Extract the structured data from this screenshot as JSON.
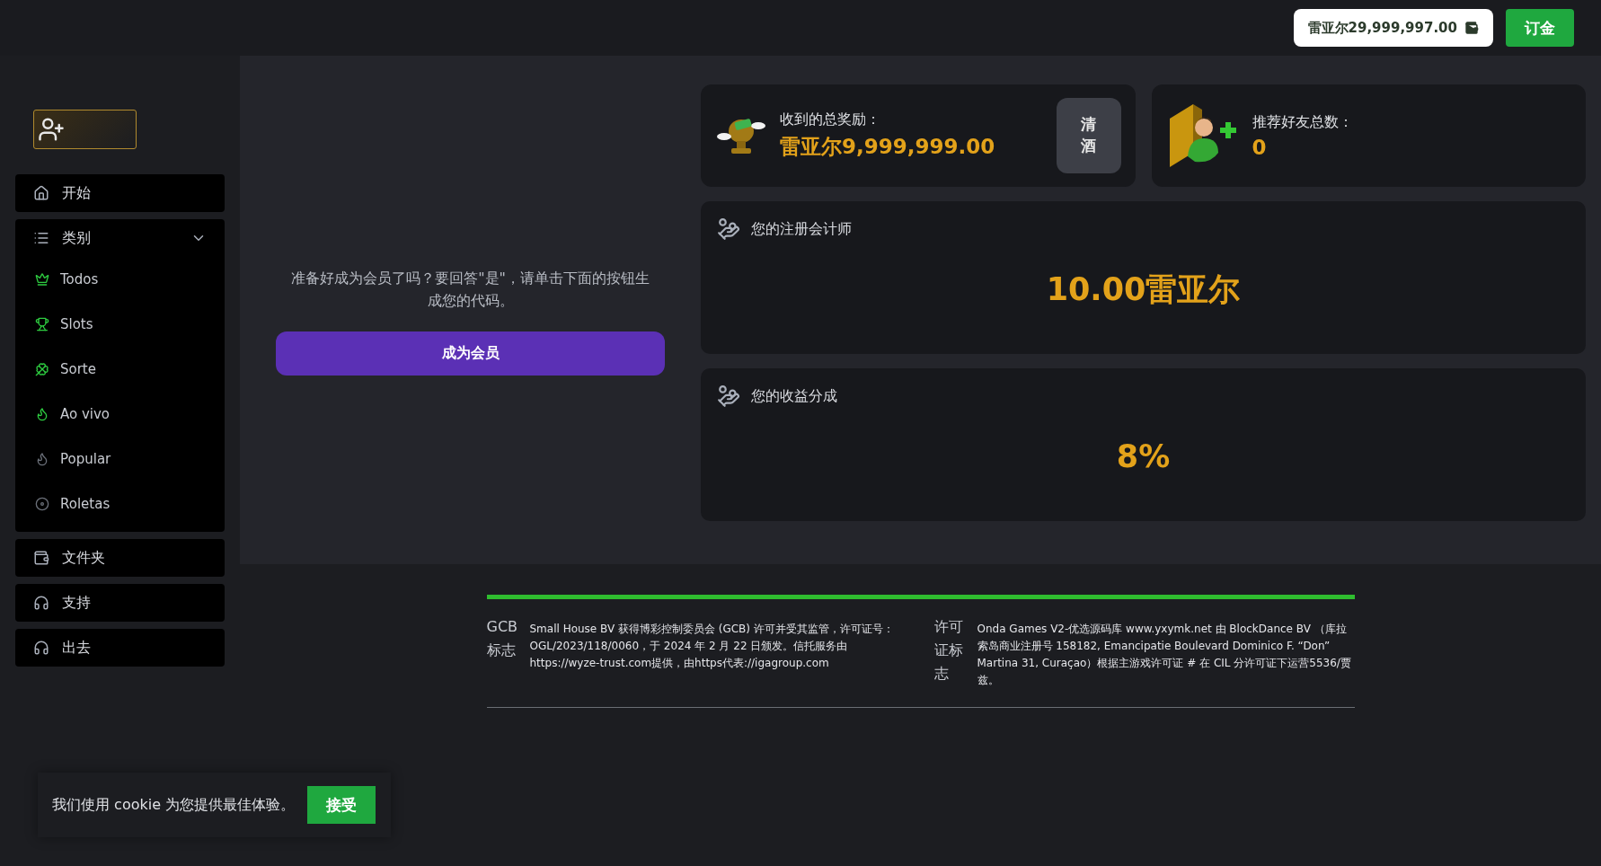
{
  "header": {
    "balance": "雷亚尔29,999,997.00",
    "deposit_button": "订金"
  },
  "sidebar": {
    "items": [
      {
        "kind": "link",
        "label": "开始"
      },
      {
        "kind": "group",
        "label": "类别",
        "expanded": true,
        "children": [
          {
            "label": "Todos",
            "color": "#2ecc40"
          },
          {
            "label": "Slots",
            "color": "#2ecc40"
          },
          {
            "label": "Sorte",
            "color": "#2ecc40"
          },
          {
            "label": "Ao vivo",
            "color": "#2ecc40"
          },
          {
            "label": "Popular",
            "color": "#6b7079"
          },
          {
            "label": "Roletas",
            "color": "#6b7079"
          }
        ]
      },
      {
        "kind": "link",
        "label": "文件夹"
      },
      {
        "kind": "link",
        "label": "支持"
      },
      {
        "kind": "link",
        "label": "出去"
      }
    ]
  },
  "invite": {
    "text": "准备好成为会员了吗？要回答\"是\"，请单击下面的按钮生成您的代码。",
    "button": "成为会员"
  },
  "stats": [
    {
      "label": "收到的总奖励：",
      "value": "雷亚尔9,999,999.00",
      "action": "清酒"
    },
    {
      "label": "推荐好友总数：",
      "value": "0"
    }
  ],
  "panels": [
    {
      "title": "您的注册会计师",
      "value": "10.00雷亚尔"
    },
    {
      "title": "您的收益分成",
      "value": "8%"
    }
  ],
  "footer": {
    "licenses": [
      {
        "image_alt": "GCB标志",
        "text": "Small House BV 获得博彩控制委员会 (GCB) 许可并受其监管，许可证号：OGL/2023/118/0060，于 2024 年 2 月 22 日颁发。信托服务由https://wyze-trust.com提供，由https代表://igagroup.com"
      },
      {
        "image_alt": "许可证标志",
        "text": "Onda Games V2-优选源码库 www.yxymk.net 由 BlockDance BV （库拉索岛商业注册号 158182, Emancipatie Boulevard Dominico F. “Don” Martina 31, Curaçao）根据主游戏许可证 # 在 CIL 分许可证下运营5536/贾兹。"
      }
    ]
  },
  "cookie": {
    "text": "我们使用 cookie 为您提供最佳体验。",
    "button": "接受"
  }
}
